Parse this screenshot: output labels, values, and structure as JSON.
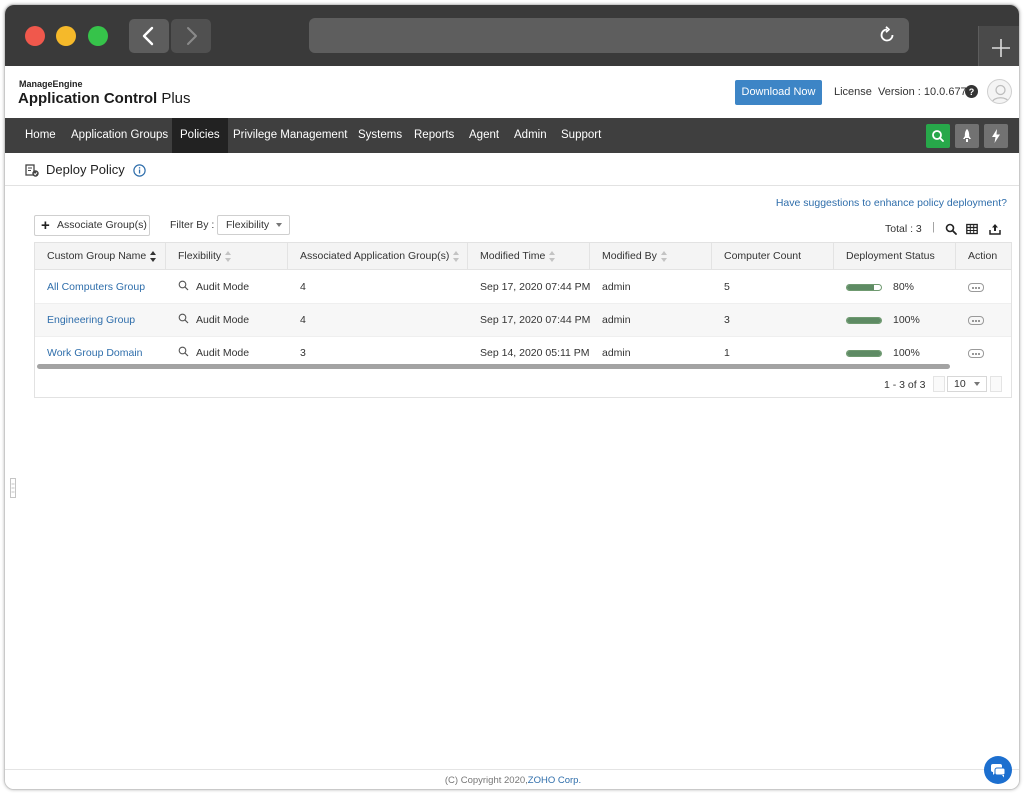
{
  "app": {
    "brand_small": "ManageEngine",
    "brand_main": "Application Control",
    "brand_suffix": "Plus",
    "download_label": "Download Now",
    "license_label": "License",
    "version_label": "Version : 10.0.677"
  },
  "nav": {
    "items": [
      "Home",
      "Application Groups",
      "Policies",
      "Privilege Management",
      "Systems",
      "Reports",
      "Agent",
      "Admin",
      "Support"
    ],
    "active": "Policies"
  },
  "page": {
    "title": "Deploy Policy",
    "suggestion_link": "Have suggestions to enhance policy deployment?"
  },
  "toolbar": {
    "associate_label": "Associate Group(s)",
    "filter_label": "Filter By :",
    "filter_value": "Flexibility",
    "total_label": "Total : 3"
  },
  "table": {
    "columns": [
      "Custom Group Name",
      "Flexibility",
      "Associated Application Group(s)",
      "Modified Time",
      "Modified By",
      "Computer Count",
      "Deployment Status",
      "Action"
    ],
    "rows": [
      {
        "name": "All Computers Group",
        "flexibility": "Audit Mode",
        "app_groups": "4",
        "modified_time": "Sep 17, 2020 07:44 PM",
        "modified_by": "admin",
        "computer_count": "5",
        "status_pct": 80,
        "status_label": "80%"
      },
      {
        "name": "Engineering Group",
        "flexibility": "Audit Mode",
        "app_groups": "4",
        "modified_time": "Sep 17, 2020 07:44 PM",
        "modified_by": "admin",
        "computer_count": "3",
        "status_pct": 100,
        "status_label": "100%"
      },
      {
        "name": "Work Group Domain",
        "flexibility": "Audit Mode",
        "app_groups": "3",
        "modified_time": "Sep 14, 2020 05:11 PM",
        "modified_by": "admin",
        "computer_count": "1",
        "status_pct": 100,
        "status_label": "100%"
      }
    ]
  },
  "pagination": {
    "range_label": "1 - 3 of 3",
    "page_size": "10"
  },
  "footer": {
    "copyright": "(C) Copyright 2020,",
    "company": "ZOHO Corp."
  },
  "colors": {
    "accent": "#3d85c6",
    "nav_bg": "#3f3f3f",
    "nav_active": "#222222",
    "search_btn": "#27a84a",
    "status_fill": "#5e8b64",
    "link": "#2f6eab"
  },
  "icons": [
    "back-arrow-icon",
    "forward-arrow-icon",
    "reload-icon",
    "new-tab-plus-icon",
    "help-icon",
    "avatar-icon",
    "search-icon",
    "rocket-icon",
    "bolt-icon",
    "deploy-policy-icon",
    "info-icon",
    "plus-icon",
    "table-search-icon",
    "column-chooser-icon",
    "export-icon",
    "magnifier-icon",
    "more-options-icon",
    "chat-icon"
  ]
}
